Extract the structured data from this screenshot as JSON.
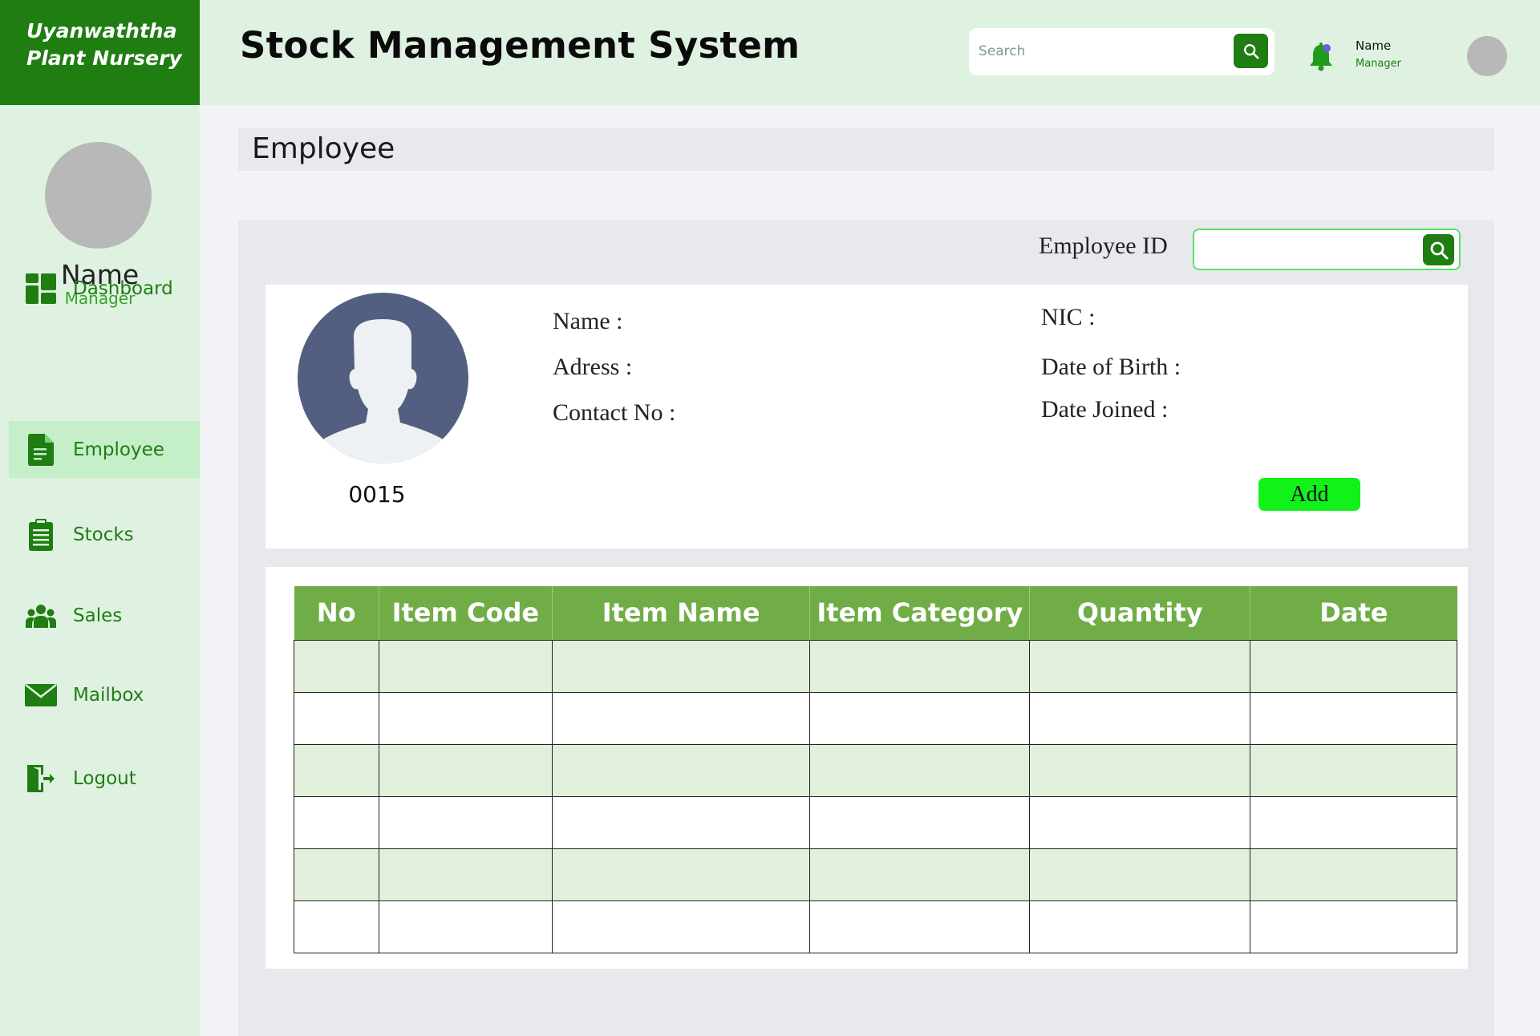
{
  "brand": {
    "line1": "Uyanwaththa",
    "line2": "Plant Nursery"
  },
  "header": {
    "title": "Stock Management System",
    "search_placeholder": "Search",
    "user_name": "Name",
    "user_role": "Manager"
  },
  "sidebar": {
    "profile_name": "Name",
    "profile_role": "Manager",
    "items": [
      {
        "label": "Dashboard",
        "icon": "dashboard-icon",
        "active": false
      },
      {
        "label": "Employee",
        "icon": "document-icon",
        "active": true
      },
      {
        "label": "Stocks",
        "icon": "clipboard-icon",
        "active": false
      },
      {
        "label": "Sales",
        "icon": "people-icon",
        "active": false
      },
      {
        "label": "Mailbox",
        "icon": "mail-icon",
        "active": false
      },
      {
        "label": "Logout",
        "icon": "logout-icon",
        "active": false
      }
    ]
  },
  "page": {
    "title": "Employee"
  },
  "employee_search": {
    "label": "Employee ID",
    "value": ""
  },
  "employee": {
    "number": "0015",
    "fields": {
      "name": "Name :",
      "address": "Adress :",
      "contact": "Contact No :",
      "nic": "NIC :",
      "dob": "Date of Birth :",
      "joined": "Date Joined :"
    },
    "add_label": "Add"
  },
  "table": {
    "headers": [
      "No",
      "Item Code",
      "Item Name",
      "Item Category",
      "Quantity",
      "Date"
    ],
    "rows": [
      [
        "",
        "",
        "",
        "",
        "",
        ""
      ],
      [
        "",
        "",
        "",
        "",
        "",
        ""
      ],
      [
        "",
        "",
        "",
        "",
        "",
        ""
      ],
      [
        "",
        "",
        "",
        "",
        "",
        ""
      ],
      [
        "",
        "",
        "",
        "",
        "",
        ""
      ],
      [
        "",
        "",
        "",
        "",
        "",
        ""
      ]
    ]
  },
  "colors": {
    "brand_green": "#1f7d12",
    "light_green_bg": "#dff2e1",
    "active_nav": "#c4efc8",
    "table_header": "#70ad47",
    "table_alt_row": "#e2efda",
    "add_button": "#12f21a",
    "avatar_dark": "#535f80"
  }
}
